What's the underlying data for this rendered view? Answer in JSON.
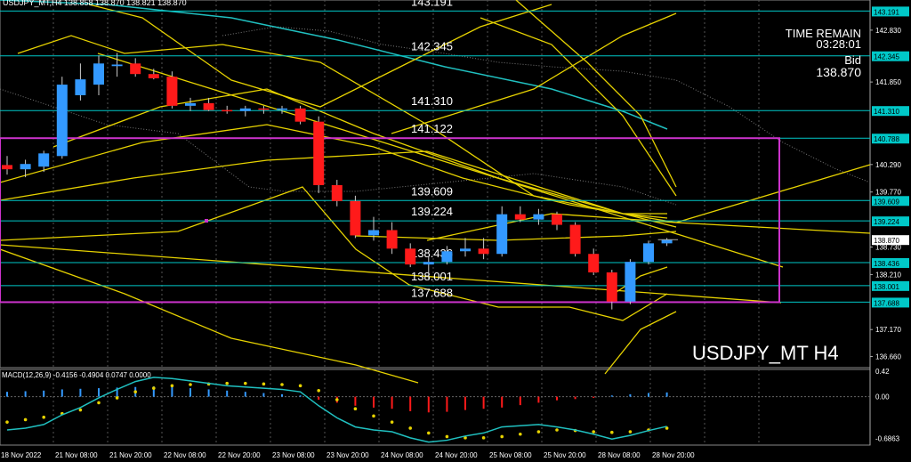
{
  "header": {
    "symbol_info": "USDJPY_MT,H4  138.858 138.870 138.821 138.870"
  },
  "info": {
    "time_remain_label": "TIME REMAIN",
    "time_remain": "03:28:01",
    "bid_label": "Bid",
    "bid": "138.870"
  },
  "symbol_title": "USDJPY_MT H4",
  "macd": {
    "label": "MACD(12,26,9) -0.4156 -0.4904 0.0747 0.0000"
  },
  "price_axis": {
    "ticks": [
      "142.830",
      "142.345",
      "141.850",
      "141.310",
      "140.788",
      "140.290",
      "139.770",
      "139.609",
      "139.224",
      "138.870",
      "138.730",
      "138.436",
      "138.210",
      "138.001",
      "137.688",
      "137.170",
      "136.660"
    ],
    "macd_ticks": [
      "0.42",
      "0.00",
      "-0.6863"
    ]
  },
  "time_axis": [
    "18 Nov 2022",
    "21 Nov 08:00",
    "21 Nov 20:00",
    "22 Nov 08:00",
    "22 Nov 20:00",
    "23 Nov 08:00",
    "23 Nov 20:00",
    "24 Nov 08:00",
    "24 Nov 20:00",
    "25 Nov 08:00",
    "25 Nov 20:00",
    "28 Nov 08:00",
    "28 Nov 20:00"
  ],
  "levels": [
    {
      "label": "143.191",
      "price": 143.191
    },
    {
      "label": "142.345",
      "price": 142.345
    },
    {
      "label": "141.310",
      "price": 141.31
    },
    {
      "label": "141.122",
      "price": 140.788
    },
    {
      "label": "139.609",
      "price": 139.609
    },
    {
      "label": "139.224",
      "price": 139.224
    },
    {
      "label": "138.436",
      "price": 138.436
    },
    {
      "label": "138.001",
      "price": 138.001
    },
    {
      "label": "137.688",
      "price": 137.688
    }
  ],
  "colors": {
    "bull": "#3399ff",
    "bear": "#ff1a1a",
    "level": "#00c8c8",
    "box": "#cc33cc",
    "trend": "#e6d200",
    "ma": "#20c0c0"
  },
  "chart_data": {
    "type": "candlestick",
    "candles": [
      {
        "o": 140.28,
        "h": 140.45,
        "l": 140.1,
        "c": 140.2
      },
      {
        "o": 140.2,
        "h": 140.38,
        "l": 140.05,
        "c": 140.3
      },
      {
        "o": 140.25,
        "h": 140.55,
        "l": 140.15,
        "c": 140.5
      },
      {
        "o": 140.45,
        "h": 141.95,
        "l": 140.4,
        "c": 141.8
      },
      {
        "o": 141.6,
        "h": 142.2,
        "l": 141.5,
        "c": 141.9
      },
      {
        "o": 141.8,
        "h": 142.35,
        "l": 141.6,
        "c": 142.2
      },
      {
        "o": 142.15,
        "h": 142.4,
        "l": 141.95,
        "c": 142.18
      },
      {
        "o": 142.2,
        "h": 142.3,
        "l": 141.95,
        "c": 142.0
      },
      {
        "o": 142.0,
        "h": 142.1,
        "l": 141.9,
        "c": 141.92
      },
      {
        "o": 141.95,
        "h": 142.05,
        "l": 141.35,
        "c": 141.4
      },
      {
        "o": 141.4,
        "h": 141.55,
        "l": 141.3,
        "c": 141.45
      },
      {
        "o": 141.45,
        "h": 141.55,
        "l": 141.3,
        "c": 141.32
      },
      {
        "o": 141.32,
        "h": 141.4,
        "l": 141.25,
        "c": 141.3
      },
      {
        "o": 141.3,
        "h": 141.4,
        "l": 141.2,
        "c": 141.35
      },
      {
        "o": 141.35,
        "h": 141.4,
        "l": 141.25,
        "c": 141.33
      },
      {
        "o": 141.33,
        "h": 141.4,
        "l": 141.25,
        "c": 141.35
      },
      {
        "o": 141.35,
        "h": 141.4,
        "l": 141.05,
        "c": 141.1
      },
      {
        "o": 141.1,
        "h": 141.2,
        "l": 139.75,
        "c": 139.9
      },
      {
        "o": 139.9,
        "h": 140.0,
        "l": 139.5,
        "c": 139.6
      },
      {
        "o": 139.6,
        "h": 139.7,
        "l": 138.9,
        "c": 138.95
      },
      {
        "o": 138.95,
        "h": 139.3,
        "l": 138.85,
        "c": 139.05
      },
      {
        "o": 139.05,
        "h": 139.2,
        "l": 138.6,
        "c": 138.7
      },
      {
        "o": 138.7,
        "h": 138.8,
        "l": 138.35,
        "c": 138.4
      },
      {
        "o": 138.4,
        "h": 138.55,
        "l": 138.1,
        "c": 138.45
      },
      {
        "o": 138.45,
        "h": 138.75,
        "l": 138.4,
        "c": 138.65
      },
      {
        "o": 138.65,
        "h": 138.9,
        "l": 138.55,
        "c": 138.7
      },
      {
        "o": 138.7,
        "h": 138.9,
        "l": 138.5,
        "c": 138.6
      },
      {
        "o": 138.6,
        "h": 139.5,
        "l": 138.55,
        "c": 139.35
      },
      {
        "o": 139.35,
        "h": 139.5,
        "l": 139.2,
        "c": 139.25
      },
      {
        "o": 139.25,
        "h": 139.45,
        "l": 139.15,
        "c": 139.35
      },
      {
        "o": 139.35,
        "h": 139.4,
        "l": 139.05,
        "c": 139.15
      },
      {
        "o": 139.15,
        "h": 139.2,
        "l": 138.55,
        "c": 138.6
      },
      {
        "o": 138.6,
        "h": 138.7,
        "l": 138.2,
        "c": 138.25
      },
      {
        "o": 138.25,
        "h": 138.3,
        "l": 137.55,
        "c": 137.7
      },
      {
        "o": 137.7,
        "h": 138.5,
        "l": 137.65,
        "c": 138.45
      },
      {
        "o": 138.45,
        "h": 138.85,
        "l": 138.4,
        "c": 138.8
      },
      {
        "o": 138.8,
        "h": 138.9,
        "l": 138.75,
        "c": 138.87
      }
    ],
    "macd_hist": [
      0.08,
      0.09,
      0.1,
      0.12,
      0.13,
      0.14,
      0.15,
      0.16,
      0.17,
      0.16,
      0.14,
      0.12,
      0.1,
      0.08,
      0.06,
      0.04,
      0.02,
      -0.05,
      -0.1,
      -0.15,
      -0.18,
      -0.2,
      -0.24,
      -0.26,
      -0.25,
      -0.22,
      -0.2,
      -0.18,
      -0.14,
      -0.1,
      -0.06,
      -0.04,
      -0.02,
      0.02,
      0.04,
      0.06,
      0.07
    ],
    "macd_signal": [
      -0.42,
      -0.38,
      -0.34,
      -0.28,
      -0.22,
      -0.1,
      -0.02,
      0.08,
      0.14,
      0.18,
      0.2,
      0.21,
      0.22,
      0.22,
      0.21,
      0.2,
      0.18,
      0.1,
      -0.05,
      -0.2,
      -0.32,
      -0.42,
      -0.52,
      -0.6,
      -0.66,
      -0.68,
      -0.68,
      -0.66,
      -0.62,
      -0.58,
      -0.55,
      -0.56,
      -0.58,
      -0.59,
      -0.58,
      -0.55,
      -0.52
    ],
    "macd_main": [
      -0.55,
      -0.52,
      -0.46,
      -0.3,
      -0.18,
      -0.02,
      0.12,
      0.25,
      0.32,
      0.3,
      0.26,
      0.22,
      0.18,
      0.16,
      0.14,
      0.12,
      0.08,
      -0.15,
      -0.35,
      -0.5,
      -0.55,
      -0.58,
      -0.68,
      -0.75,
      -0.72,
      -0.65,
      -0.6,
      -0.5,
      -0.48,
      -0.46,
      -0.5,
      -0.55,
      -0.62,
      -0.7,
      -0.64,
      -0.56,
      -0.49
    ]
  }
}
